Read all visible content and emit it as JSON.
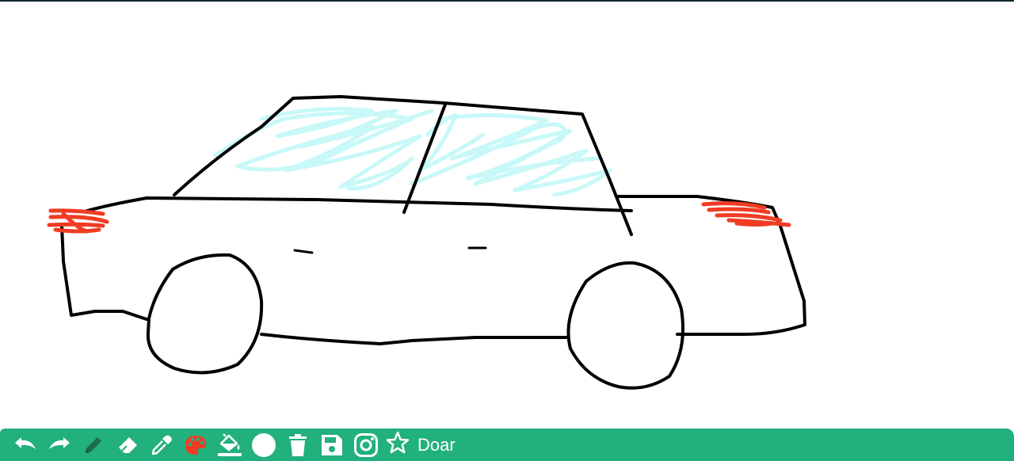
{
  "toolbar": {
    "tools": [
      {
        "icon": "undo-icon",
        "tooltip": ""
      },
      {
        "icon": "redo-icon",
        "tooltip": ""
      },
      {
        "icon": "pencil-icon",
        "tooltip": ""
      },
      {
        "icon": "eraser-icon",
        "tooltip": ""
      },
      {
        "icon": "eyedropper-icon",
        "tooltip": ""
      },
      {
        "icon": "palette-icon",
        "tooltip": ""
      },
      {
        "icon": "fill-bucket-icon",
        "tooltip": ""
      },
      {
        "icon": "brush-size-icon",
        "tooltip": ""
      },
      {
        "icon": "trash-icon",
        "tooltip": ""
      },
      {
        "icon": "save-icon",
        "tooltip": ""
      },
      {
        "icon": "instagram-icon",
        "tooltip": ""
      }
    ],
    "donate_label": "Doar",
    "donate_icon": "star-icon"
  },
  "colors": {
    "toolbar_background": "#22b07d",
    "toolbar_icon": "#ffffff",
    "active_tool_color": "#1d6b4a",
    "selected_paint_color": "#f03c24",
    "canvas_background": "#ffffff",
    "stroke_black": "#000000",
    "window_tint": "#c8f8f8",
    "light_red": "#f03c24"
  },
  "drawing": {
    "subject": "car"
  }
}
